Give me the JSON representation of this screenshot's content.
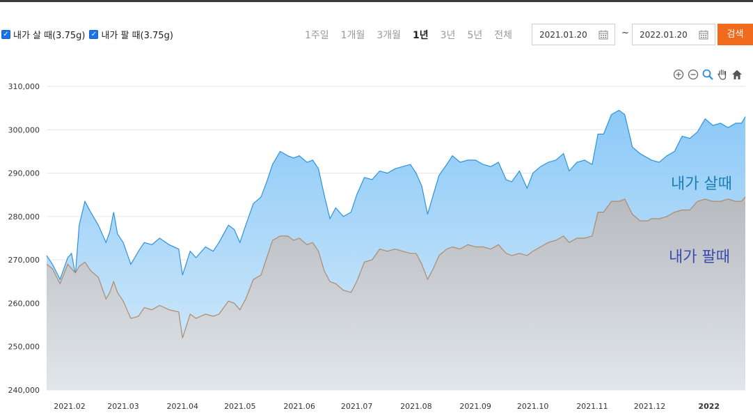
{
  "legend": {
    "buy_label": "내가 살 때(3.75g)",
    "sell_label": "내가 팔 때(3.75g)"
  },
  "periods": [
    {
      "label": "1주일",
      "active": false
    },
    {
      "label": "1개월",
      "active": false
    },
    {
      "label": "3개월",
      "active": false
    },
    {
      "label": "1년",
      "active": true
    },
    {
      "label": "3년",
      "active": false
    },
    {
      "label": "5년",
      "active": false
    },
    {
      "label": "전체",
      "active": false
    }
  ],
  "date_range": {
    "start": "2021.01.20",
    "separator": "~",
    "end": "2022.01.20"
  },
  "search_label": "검색",
  "tools": [
    "zoom-in-icon",
    "zoom-out-icon",
    "magnifier-icon",
    "pan-hand-icon",
    "home-icon"
  ],
  "colors": {
    "buy_line": "#2b93de",
    "buy_fill": "#8cc9f7",
    "sell_line": "#b0896a",
    "sell_fill": "#b9bec3",
    "buy_annotation": "#1a7db4",
    "sell_annotation": "#3c4bb0",
    "search_button": "#f26a1b"
  },
  "chart_data": {
    "type": "area",
    "title": "",
    "xlabel": "",
    "ylabel": "",
    "ylim": [
      240000,
      310000
    ],
    "yticks": [
      "240,000",
      "250,000",
      "260,000",
      "270,000",
      "280,000",
      "290,000",
      "300,000",
      "310,000"
    ],
    "xticks": [
      "2021.02",
      "2021.03",
      "2021.04",
      "2021.05",
      "2021.06",
      "2021.07",
      "2021.08",
      "2021.09",
      "2021.10",
      "2021.11",
      "2021.12",
      "2022"
    ],
    "xtick_dates": [
      "2021-02-01",
      "2021-03-01",
      "2021-04-01",
      "2021-05-01",
      "2021-06-01",
      "2021-07-01",
      "2021-08-01",
      "2021-09-01",
      "2021-10-01",
      "2021-11-01",
      "2021-12-01",
      "2022-01-01"
    ],
    "xlim": [
      "2021-01-20",
      "2022-01-20"
    ],
    "grid": true,
    "annotations": [
      {
        "text": "내가 살때",
        "series": "buy"
      },
      {
        "text": "내가 팔때",
        "series": "sell"
      }
    ],
    "series": [
      {
        "key": "buy",
        "dates": [
          "2021-01-20",
          "2021-01-23",
          "2021-01-27",
          "2021-01-31",
          "2021-02-02",
          "2021-02-04",
          "2021-02-06",
          "2021-02-09",
          "2021-02-12",
          "2021-02-16",
          "2021-02-20",
          "2021-02-22",
          "2021-02-24",
          "2021-02-26",
          "2021-03-01",
          "2021-03-05",
          "2021-03-09",
          "2021-03-12",
          "2021-03-16",
          "2021-03-20",
          "2021-03-25",
          "2021-03-30",
          "2021-04-01",
          "2021-04-05",
          "2021-04-08",
          "2021-04-13",
          "2021-04-17",
          "2021-04-20",
          "2021-04-25",
          "2021-04-28",
          "2021-05-01",
          "2021-05-04",
          "2021-05-08",
          "2021-05-12",
          "2021-05-15",
          "2021-05-18",
          "2021-05-22",
          "2021-05-26",
          "2021-05-29",
          "2021-06-01",
          "2021-06-05",
          "2021-06-08",
          "2021-06-11",
          "2021-06-14",
          "2021-06-17",
          "2021-06-20",
          "2021-06-24",
          "2021-06-28",
          "2021-07-01",
          "2021-07-05",
          "2021-07-09",
          "2021-07-13",
          "2021-07-17",
          "2021-07-21",
          "2021-07-25",
          "2021-07-29",
          "2021-08-01",
          "2021-08-04",
          "2021-08-07",
          "2021-08-10",
          "2021-08-13",
          "2021-08-17",
          "2021-08-20",
          "2021-08-24",
          "2021-08-28",
          "2021-09-01",
          "2021-09-05",
          "2021-09-09",
          "2021-09-13",
          "2021-09-17",
          "2021-09-20",
          "2021-09-24",
          "2021-09-28",
          "2021-10-01",
          "2021-10-05",
          "2021-10-09",
          "2021-10-13",
          "2021-10-17",
          "2021-10-20",
          "2021-10-24",
          "2021-10-28",
          "2021-11-01",
          "2021-11-04",
          "2021-11-07",
          "2021-11-11",
          "2021-11-15",
          "2021-11-18",
          "2021-11-22",
          "2021-11-26",
          "2021-11-30",
          "2021-12-02",
          "2021-12-06",
          "2021-12-10",
          "2021-12-14",
          "2021-12-18",
          "2021-12-22",
          "2021-12-26",
          "2021-12-30",
          "2022-01-03",
          "2022-01-07",
          "2022-01-11",
          "2022-01-15",
          "2022-01-18",
          "2022-01-20"
        ],
        "values": [
          271000,
          269000,
          265500,
          270500,
          271500,
          266500,
          278000,
          283500,
          281000,
          278000,
          274000,
          276500,
          281000,
          276000,
          274000,
          269000,
          272000,
          274000,
          273500,
          275000,
          273500,
          272500,
          266500,
          272000,
          270500,
          273000,
          272000,
          274000,
          278000,
          277000,
          274000,
          278000,
          283000,
          284500,
          288000,
          292000,
          295000,
          294000,
          293500,
          294000,
          292500,
          293000,
          291000,
          285000,
          279500,
          282000,
          280000,
          281000,
          285000,
          289000,
          288500,
          290500,
          290000,
          291000,
          291500,
          292000,
          290000,
          287000,
          280500,
          285000,
          289500,
          292000,
          294000,
          292500,
          293000,
          293000,
          292000,
          291500,
          292500,
          288500,
          288000,
          290500,
          286500,
          290000,
          291500,
          292500,
          293000,
          294500,
          290500,
          292500,
          293000,
          292000,
          299000,
          299000,
          303500,
          304500,
          303500,
          296000,
          294500,
          293500,
          293000,
          292500,
          294000,
          295000,
          298500,
          298000,
          299500,
          302500,
          301000,
          301500,
          300500,
          301500,
          301500,
          303000
        ]
      },
      {
        "key": "sell",
        "dates": [
          "2021-01-20",
          "2021-01-23",
          "2021-01-27",
          "2021-01-31",
          "2021-02-02",
          "2021-02-04",
          "2021-02-06",
          "2021-02-09",
          "2021-02-12",
          "2021-02-16",
          "2021-02-20",
          "2021-02-22",
          "2021-02-24",
          "2021-02-26",
          "2021-03-01",
          "2021-03-05",
          "2021-03-09",
          "2021-03-12",
          "2021-03-16",
          "2021-03-20",
          "2021-03-25",
          "2021-03-30",
          "2021-04-01",
          "2021-04-05",
          "2021-04-08",
          "2021-04-13",
          "2021-04-17",
          "2021-04-20",
          "2021-04-25",
          "2021-04-28",
          "2021-05-01",
          "2021-05-04",
          "2021-05-08",
          "2021-05-12",
          "2021-05-15",
          "2021-05-18",
          "2021-05-22",
          "2021-05-26",
          "2021-05-29",
          "2021-06-01",
          "2021-06-05",
          "2021-06-08",
          "2021-06-11",
          "2021-06-14",
          "2021-06-17",
          "2021-06-20",
          "2021-06-24",
          "2021-06-28",
          "2021-07-01",
          "2021-07-05",
          "2021-07-09",
          "2021-07-13",
          "2021-07-17",
          "2021-07-21",
          "2021-07-25",
          "2021-07-29",
          "2021-08-01",
          "2021-08-04",
          "2021-08-07",
          "2021-08-10",
          "2021-08-13",
          "2021-08-17",
          "2021-08-20",
          "2021-08-24",
          "2021-08-28",
          "2021-09-01",
          "2021-09-05",
          "2021-09-09",
          "2021-09-13",
          "2021-09-17",
          "2021-09-20",
          "2021-09-24",
          "2021-09-28",
          "2021-10-01",
          "2021-10-05",
          "2021-10-09",
          "2021-10-13",
          "2021-10-17",
          "2021-10-20",
          "2021-10-24",
          "2021-10-28",
          "2021-11-01",
          "2021-11-04",
          "2021-11-07",
          "2021-11-11",
          "2021-11-15",
          "2021-11-18",
          "2021-11-22",
          "2021-11-26",
          "2021-11-30",
          "2021-12-02",
          "2021-12-06",
          "2021-12-10",
          "2021-12-14",
          "2021-12-18",
          "2021-12-22",
          "2021-12-26",
          "2021-12-30",
          "2022-01-03",
          "2022-01-07",
          "2022-01-11",
          "2022-01-15",
          "2022-01-18",
          "2022-01-20"
        ],
        "values": [
          269000,
          268000,
          264500,
          269000,
          268000,
          267000,
          268500,
          269500,
          267500,
          266000,
          261000,
          262500,
          265000,
          262500,
          260500,
          256500,
          257000,
          259000,
          258500,
          259500,
          258500,
          258000,
          252000,
          257500,
          256500,
          257500,
          257000,
          257500,
          260500,
          260000,
          258500,
          261000,
          265500,
          266500,
          270500,
          274500,
          275500,
          275500,
          274500,
          275000,
          273500,
          274000,
          272000,
          267500,
          265000,
          264500,
          263000,
          262500,
          265000,
          269500,
          270000,
          272500,
          272000,
          272500,
          272000,
          271500,
          271500,
          269000,
          265500,
          268000,
          271000,
          272500,
          273000,
          272500,
          273500,
          273000,
          273000,
          272500,
          273500,
          271500,
          271000,
          271500,
          271000,
          272000,
          273000,
          274000,
          274500,
          275500,
          274000,
          275000,
          275000,
          275500,
          281000,
          281000,
          283500,
          283500,
          284000,
          280500,
          279000,
          279000,
          279500,
          279500,
          280000,
          281000,
          281500,
          281500,
          283500,
          284000,
          283500,
          283500,
          284000,
          283500,
          283500,
          284500
        ]
      }
    ]
  }
}
